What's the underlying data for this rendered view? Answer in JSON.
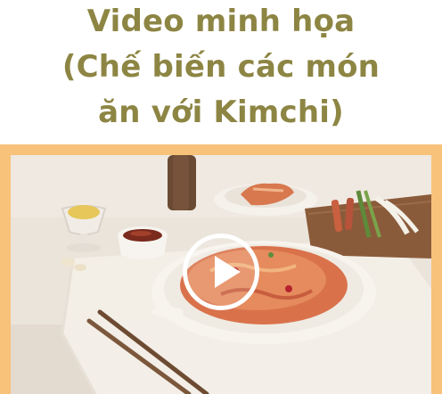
{
  "title": {
    "line1": "Video minh họa",
    "line2": "(Chế biến các món",
    "line3": "ăn với Kimchi)"
  },
  "video": {
    "play_icon": "play-icon",
    "colors": {
      "frame": "#f8c27a",
      "title": "#8d8543",
      "play": "#ffffff"
    }
  }
}
